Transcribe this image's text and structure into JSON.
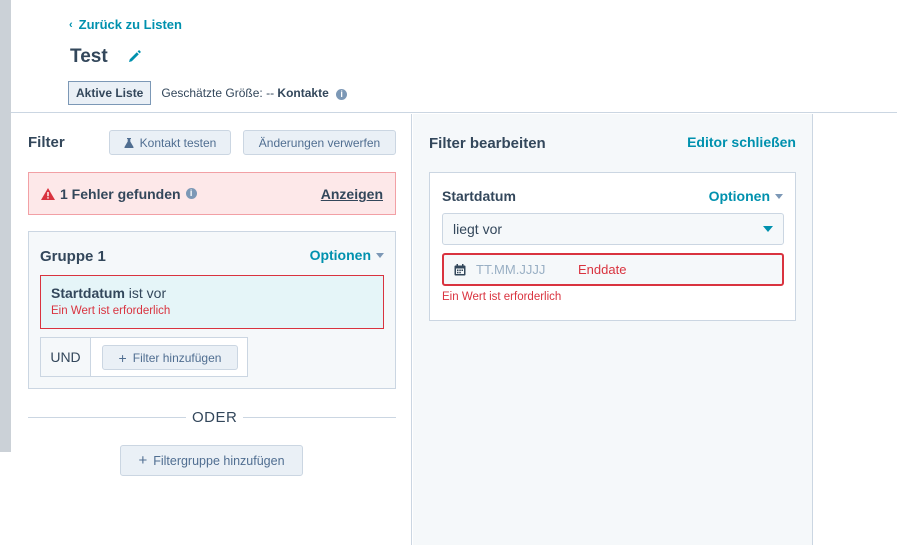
{
  "header": {
    "back_label": "Zurück zu Listen",
    "title": "Test",
    "list_type_tag": "Aktive Liste",
    "size_label": "Geschätzte Größe:",
    "size_value": "--",
    "size_unit": "Kontakte"
  },
  "filter_panel": {
    "heading": "Filter",
    "test_contact_label": "Kontakt testen",
    "discard_label": "Änderungen verwerfen",
    "error": {
      "message": "1 Fehler gefunden",
      "show_label": "Anzeigen"
    },
    "group": {
      "title": "Gruppe 1",
      "options_label": "Optionen",
      "condition_field": "Startdatum",
      "condition_operator": "ist vor",
      "condition_error": "Ein Wert ist erforderlich",
      "and_label": "UND",
      "add_filter_label": "Filter hinzufügen"
    },
    "or_label": "ODER",
    "add_group_label": "Filtergruppe hinzufügen"
  },
  "editor_panel": {
    "heading": "Filter bearbeiten",
    "close_label": "Editor schließen",
    "field_label": "Startdatum",
    "options_label": "Optionen",
    "operator_value": "liegt vor",
    "date_placeholder": "TT.MM.JJJJ",
    "date_end_label": "Enddate",
    "error_message": "Ein Wert ist erforderlich"
  },
  "colors": {
    "accent": "#0091ae",
    "error": "#d9333f",
    "text": "#33475b",
    "panel_bg": "#f5f8fa",
    "error_bg": "#fde8e9"
  }
}
